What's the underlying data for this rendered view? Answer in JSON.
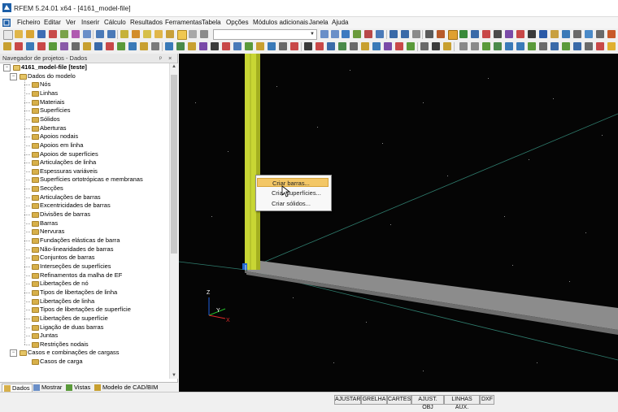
{
  "window": {
    "title": "RFEM 5.24.01 x64 - [4161_model-file]"
  },
  "menu": [
    "Ficheiro",
    "Editar",
    "Ver",
    "Inserir",
    "Cálculo",
    "Resultados",
    "Ferramentas",
    "Tabela",
    "Opções",
    "Módulos adicionais",
    "Janela",
    "Ajuda"
  ],
  "navigator": {
    "title": "Navegador de projetos - Dados",
    "root": "4161_model-file [teste]",
    "group1": "Dados do modelo",
    "items": [
      "Nós",
      "Linhas",
      "Materiais",
      "Superfícies",
      "Sólidos",
      "Aberturas",
      "Apoios nodais",
      "Apoios em linha",
      "Apoios de superfícies",
      "Articulações de linha",
      "Espessuras variáveis",
      "Superfícies ortotrópicas e membranas",
      "Secções",
      "Articulações de barras",
      "Excentricidades de barras",
      "Divisões de barras",
      "Barras",
      "Nervuras",
      "Fundações elásticas de barra",
      "Não-linearidades de barras",
      "Conjuntos de barras",
      "Interseções de superfícies",
      "Refinamentos da malha de EF",
      "Libertações de nó",
      "Tipos de libertações de linha",
      "Libertações de linha",
      "Tipos de libertações de superfície",
      "Libertações de superfície",
      "Ligação de duas barras",
      "Juntas",
      "Restrições nodais"
    ],
    "group2": "Casos e combinações de cargass",
    "group2_items": [
      "Casos de carga"
    ],
    "tabs": [
      "Dados",
      "Mostrar",
      "Vistas",
      "Modelo de CAD/BIM"
    ]
  },
  "context_menu": {
    "items": [
      "Criar barras...",
      "Criar superfícies...",
      "Criar sólidos..."
    ],
    "highlighted": 0
  },
  "axes": {
    "z": "Z",
    "y": "Y",
    "x": "X"
  },
  "status_buttons": [
    "AJUSTAR",
    "GRELHA",
    "CARTES",
    "AJUST. OBJ",
    "LINHAS AUX.",
    "DXF"
  ],
  "colors": {
    "viewport_bg": "#050505",
    "column": "#c8d634",
    "beam": "#8c8c8c",
    "grid_line": "#2f7d6e",
    "highlight": "#f3c766"
  }
}
